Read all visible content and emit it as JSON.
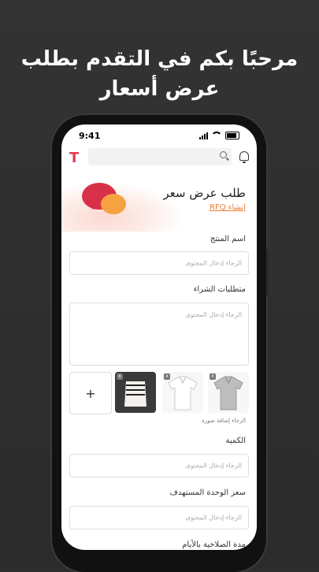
{
  "headline": {
    "line1": "مرحبًا بكم في التقدم بطلب",
    "line2": "عرض أسعار"
  },
  "status_bar": {
    "time": "9:41"
  },
  "app": {
    "logo": "T",
    "search_placeholder": ""
  },
  "banner": {
    "title": "طلب عرض سعر",
    "link": "إنشاء RFQ"
  },
  "form": {
    "product_name": {
      "label": "اسم المنتج",
      "placeholder": "الرجاء إدخال المحتوى"
    },
    "requirements": {
      "label": "متطلبات الشراء",
      "placeholder": "الرجاء إدخال المحتوى"
    },
    "images": {
      "add_label": "+",
      "note": "الرجاء إضافة صورة",
      "remove_label": "x"
    },
    "quantity": {
      "label": "الكمية",
      "placeholder": "الرجاء إدخال المحتوى"
    },
    "target_unit_price": {
      "label": "سعر الوحدة المستهدف",
      "placeholder": "الرجاء إدخال المحتوى"
    },
    "validity": {
      "label": "مدة الصلاحية بالأيام"
    }
  },
  "colors": {
    "brand": "#e53950",
    "accent": "#e87a2e",
    "bubble_red": "#d9304a",
    "bubble_orange": "#f5a340"
  }
}
